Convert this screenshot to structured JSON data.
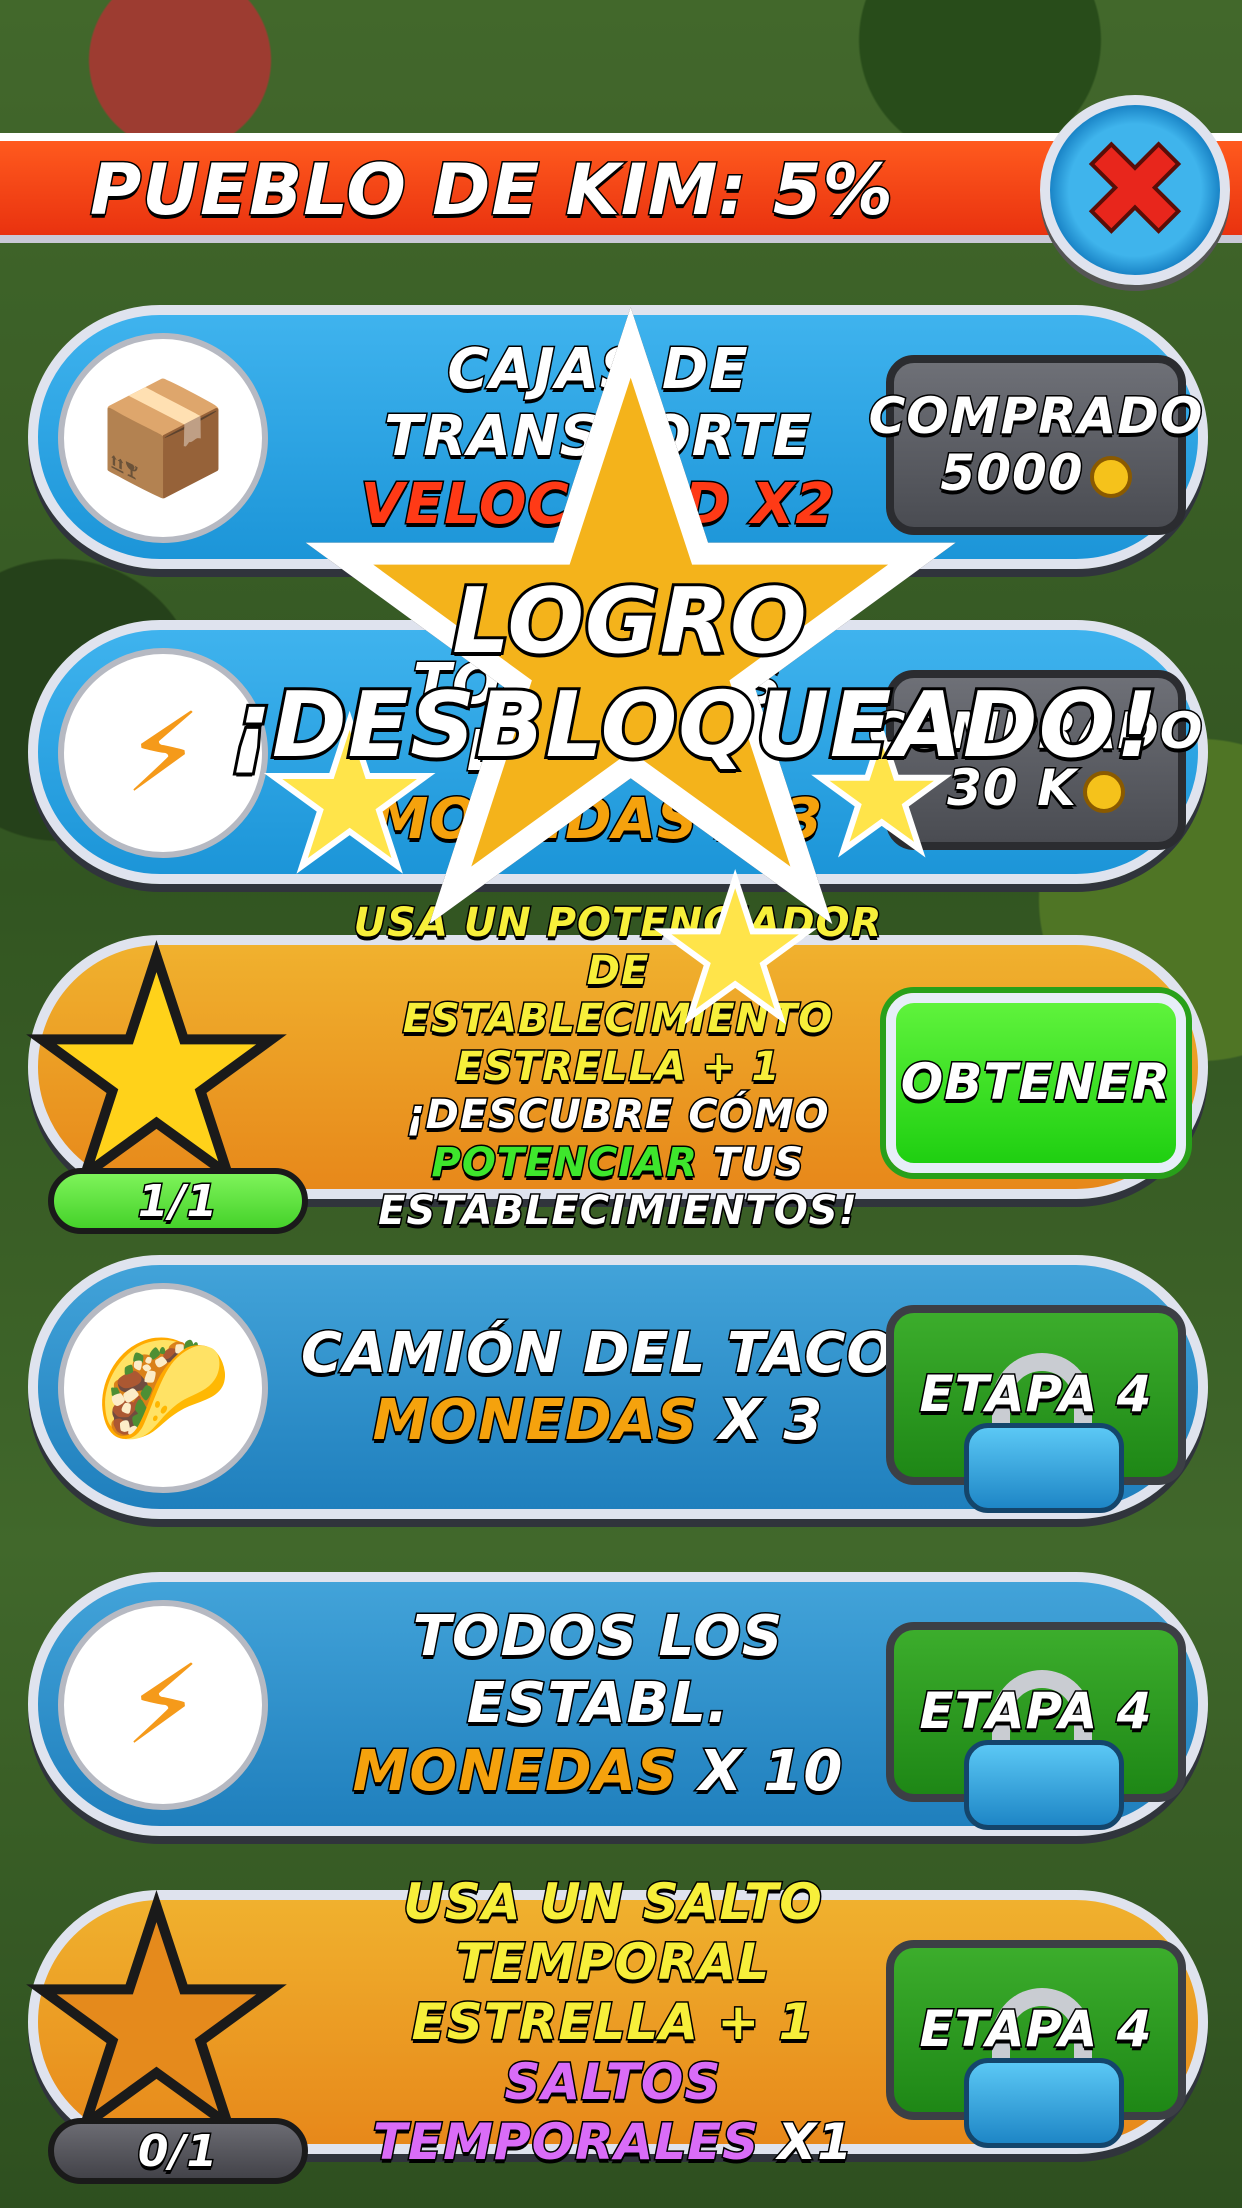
{
  "header": {
    "title": "PUEBLO DE KIM: 5%"
  },
  "close_button": {
    "icon": "close-icon"
  },
  "achievement_popup": {
    "line1": "LOGRO",
    "line2": "¡DESBLOQUEADO!"
  },
  "rows": [
    {
      "icon": "delivery-box-speed-icon",
      "line1": "CAJAS DE",
      "line2": "TRANSPORTE",
      "line3": "VELOCIDAD X2",
      "action": {
        "label": "COMPRADO",
        "amount": "5000"
      }
    },
    {
      "icon": "lightning-money-bag-icon",
      "line1": "TODOS LOS ESTABL.",
      "line2": "MONEDAS X 3",
      "action": {
        "label": "COMPRADO",
        "amount": "30 K"
      }
    },
    {
      "icon": "star-crate-icon",
      "line1": "USA UN POTENCIADOR DE",
      "line2": "ESTABLECIMIENTO",
      "line3": "ESTRELLA + 1",
      "line4_pre": "¡DESCUBRE CÓMO ",
      "line4_hl": "POTENCIAR",
      "line4_post": " TUS",
      "line5": "ESTABLECIMIENTOS!",
      "progress": "1/1",
      "progress_fraction": 1.0,
      "action": {
        "label": "OBTENER"
      }
    },
    {
      "icon": "taco-money-bag-icon",
      "line1": "CAMIÓN DEL TACO",
      "line2_hl": "MONEDAS",
      "line2_post": " X 3",
      "action": {
        "label": "ETAPA 4"
      }
    },
    {
      "icon": "lightning-money-bag-icon",
      "line1": "TODOS LOS ESTABL.",
      "line2_hl": "MONEDAS",
      "line2_post": " X 10",
      "action": {
        "label": "ETAPA 4"
      }
    },
    {
      "icon": "star-hourglass-icon",
      "line1": "USA UN SALTO TEMPORAL",
      "line2": "ESTRELLA + 1",
      "line3_hl": "SALTOS TEMPORALES",
      "line3_post": " X1",
      "progress": "0/1",
      "progress_fraction": 0.0,
      "action": {
        "label": "ETAPA 4"
      }
    }
  ],
  "colors": {
    "header_red": "#e9320f",
    "row_blue": "#1c95d8",
    "row_orange": "#e7881a",
    "button_green": "#1fcf11"
  }
}
